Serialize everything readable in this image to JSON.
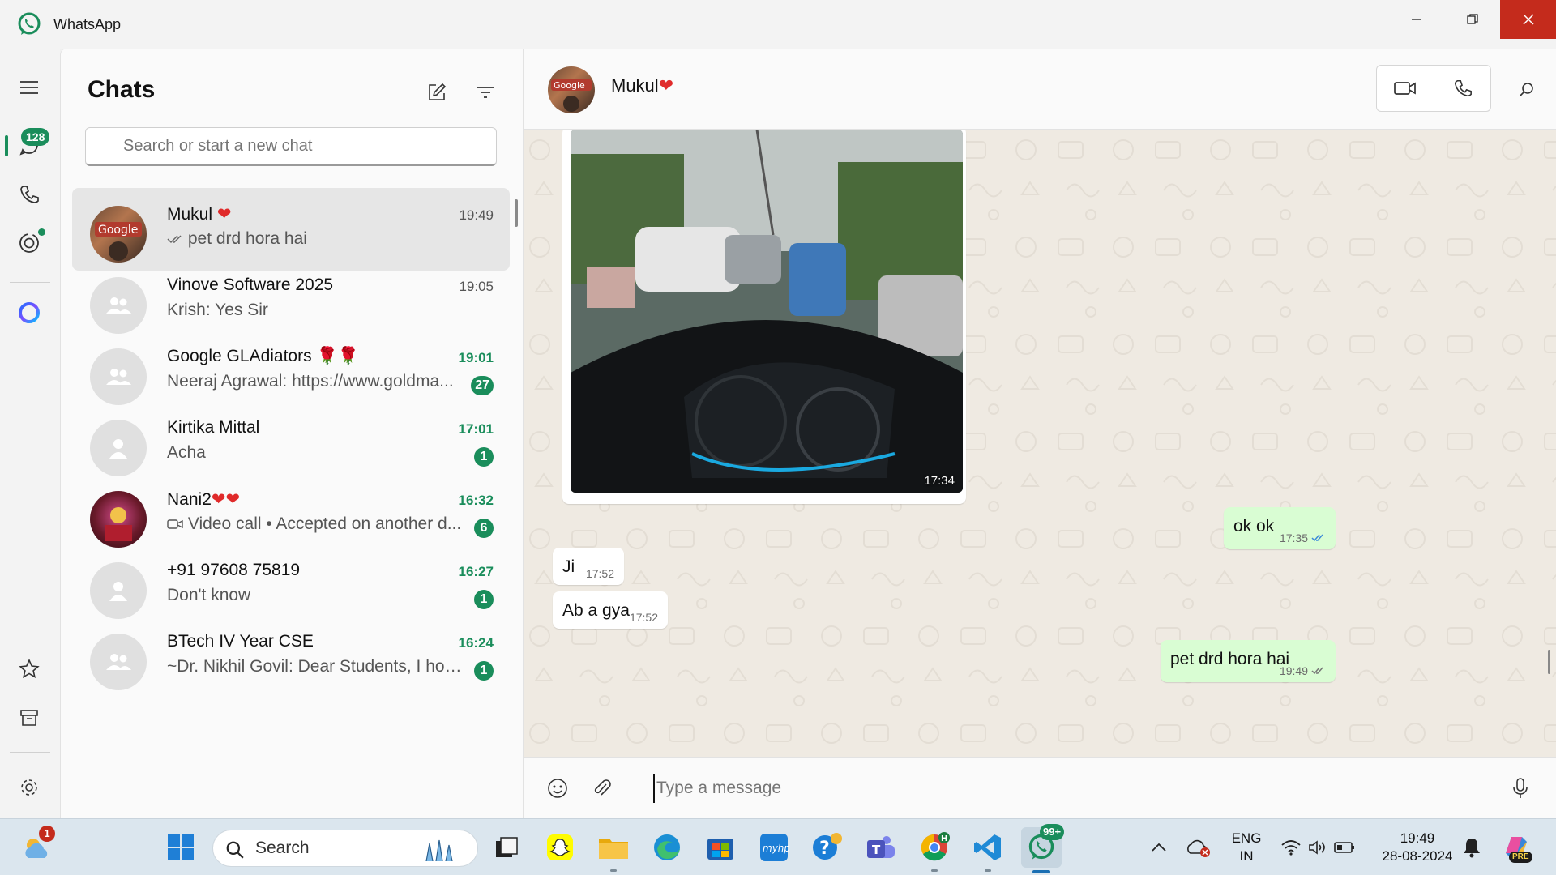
{
  "window": {
    "app_title": "WhatsApp"
  },
  "rail": {
    "chats_badge": "128",
    "items": [
      "menu-icon",
      "chats-icon",
      "calls-icon",
      "status-icon",
      "meta-ai-icon",
      "starred-icon",
      "archived-icon",
      "settings-icon",
      "profile-avatar"
    ]
  },
  "chatlist": {
    "title": "Chats",
    "search_placeholder": "Search or start a new chat",
    "items": [
      {
        "name": "Mukul",
        "preview": "pet drd hora hai",
        "time": "19:49",
        "unread": "",
        "selected": true
      },
      {
        "name": "Vinove Software 2025",
        "preview": "Krish: Yes Sir",
        "time": "19:05",
        "unread": ""
      },
      {
        "name": "Google GLAdiators",
        "preview": "Neeraj Agrawal: https://www.goldma...",
        "time": "19:01",
        "unread": "27"
      },
      {
        "name": "Kirtika Mittal",
        "preview": "Acha",
        "time": "17:01",
        "unread": "1"
      },
      {
        "name": "Nani2",
        "preview": "Video call • Accepted on another d...",
        "time": "16:32",
        "unread": "6"
      },
      {
        "name": "+91 97608 75819",
        "preview": "Don't know",
        "time": "16:27",
        "unread": "1"
      },
      {
        "name": "BTech IV Year CSE",
        "preview": "~Dr. Nikhil Govil: Dear Students, I hop...",
        "time": "16:24",
        "unread": "1"
      }
    ]
  },
  "conversation": {
    "contact_name": "Mukul",
    "photo_time": "17:34",
    "messages": [
      {
        "dir": "out",
        "text": "ok ok",
        "time": "17:35"
      },
      {
        "dir": "in",
        "text": "Ji",
        "time": "17:52"
      },
      {
        "dir": "in",
        "text": "Ab a gya",
        "time": "17:52"
      },
      {
        "dir": "out",
        "text": "pet drd hora hai",
        "time": "19:49"
      }
    ],
    "composer_placeholder": "Type a message"
  },
  "taskbar": {
    "weather_badge": "1",
    "search_label": "Search",
    "whatsapp_badge": "99+",
    "lang_top": "ENG",
    "lang_bottom": "IN",
    "time": "19:49",
    "date": "28-08-2024",
    "copilot_badge": "PRE"
  },
  "colors": {
    "accent": "#1a8d5b",
    "outgoing_bubble": "#d9fdd3",
    "chat_bg": "#efeae2",
    "close_red": "#c42b1c"
  }
}
